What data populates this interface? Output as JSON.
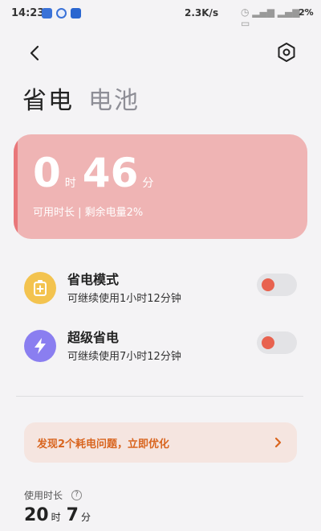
{
  "status_bar": {
    "time": "14:23",
    "network_speed": "2.3K/s",
    "battery": "2%"
  },
  "header": {
    "tabs": [
      {
        "label": "省电",
        "active": true
      },
      {
        "label": "电池",
        "active": false
      }
    ]
  },
  "battery_card": {
    "hours": "0",
    "hours_unit": "时",
    "minutes": "46",
    "minutes_unit": "分",
    "subtitle": "可用时长 | 剩余电量2%",
    "background_color": "#efb4b4"
  },
  "modes": [
    {
      "title": "省电模式",
      "description": "可继续使用1小时12分钟",
      "icon": "battery-plus-icon",
      "icon_color": "#f3c34f",
      "enabled": false
    },
    {
      "title": "超级省电",
      "description": "可继续使用7小时12分钟",
      "icon": "lightning-icon",
      "icon_color": "#8a7ef0",
      "enabled": false
    }
  ],
  "optimize_banner": {
    "text": "发现2个耗电问题，立即优化",
    "text_color": "#d9651f"
  },
  "usage": {
    "label": "使用时长",
    "hours": "20",
    "hours_unit": "时",
    "minutes": "7",
    "minutes_unit": "分"
  }
}
